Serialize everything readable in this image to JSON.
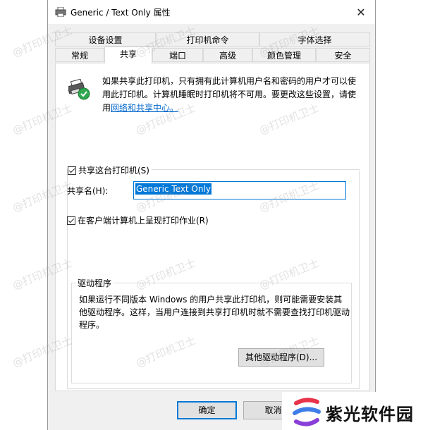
{
  "window": {
    "title": "Generic / Text Only 属性",
    "close_symbol": "✕"
  },
  "tabs_row1": [
    "设备设置",
    "打印机命令",
    "字体选择"
  ],
  "tabs_row2": [
    "常规",
    "共享",
    "端口",
    "高级",
    "颜色管理",
    "安全"
  ],
  "active_tab": "共享",
  "info": {
    "text": "如果共享此打印机，只有拥有此计算机用户名和密码的用户才可以使用此打印机。计算机睡眠时打印机将不可用。要更改这些设置，请使用",
    "link": "网络和共享中心。"
  },
  "share": {
    "checkbox_label": "共享这台打印机(S)",
    "name_label": "共享名(H):",
    "name_value": "Generic  Text Only",
    "render_jobs_label": "在客户端计算机上呈现打印作业(R)"
  },
  "drivers": {
    "legend": "驱动程序",
    "text": "如果运行不同版本 Windows 的用户共享此打印机，则可能需要安装其他驱动程序。这样，当用户连接到共享打印机时就不需要查找打印机驱动程序。",
    "button": "其他驱动程序(D)..."
  },
  "footer": {
    "ok": "确定",
    "cancel": "取消"
  },
  "watermark_text": "@打印机卫士",
  "brand": {
    "name": "紫光软件园",
    "colors": [
      "#e8334a",
      "#3f7de8",
      "#8a3fd8"
    ]
  },
  "colors": {
    "accent": "#0078d7",
    "link": "#0066cc",
    "success": "#2fa84f"
  }
}
